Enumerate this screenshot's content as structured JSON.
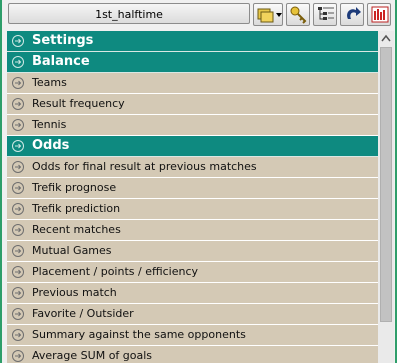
{
  "toolbar": {
    "profile": "1st_halftime",
    "buttons": [
      {
        "icon": "folder-dropdown-icon"
      },
      {
        "icon": "key-icon"
      },
      {
        "icon": "tree-list-icon"
      },
      {
        "icon": "redo-arrow-icon"
      },
      {
        "icon": "bar-chart-icon"
      }
    ]
  },
  "list": {
    "items": [
      {
        "type": "header",
        "label": "Settings"
      },
      {
        "type": "header",
        "label": "Balance"
      },
      {
        "type": "item",
        "label": "Teams"
      },
      {
        "type": "item",
        "label": "Result frequency"
      },
      {
        "type": "item",
        "label": "Tennis"
      },
      {
        "type": "header",
        "label": "Odds"
      },
      {
        "type": "item",
        "label": "Odds for final result at previous matches"
      },
      {
        "type": "item",
        "label": "Trefik prognose"
      },
      {
        "type": "item",
        "label": "Trefik prediction"
      },
      {
        "type": "item",
        "label": "Recent matches"
      },
      {
        "type": "item",
        "label": "Mutual Games"
      },
      {
        "type": "item",
        "label": "Placement / points / efficiency"
      },
      {
        "type": "item",
        "label": "Previous match"
      },
      {
        "type": "item",
        "label": "Favorite / Outsider"
      },
      {
        "type": "item",
        "label": "Summary against the same opponents"
      },
      {
        "type": "item",
        "label": "Average SUM of goals"
      }
    ]
  },
  "colors": {
    "header_bg": "#0e8a80",
    "item_bg": "#d4c9b5",
    "window_border": "#2e9e6a"
  }
}
